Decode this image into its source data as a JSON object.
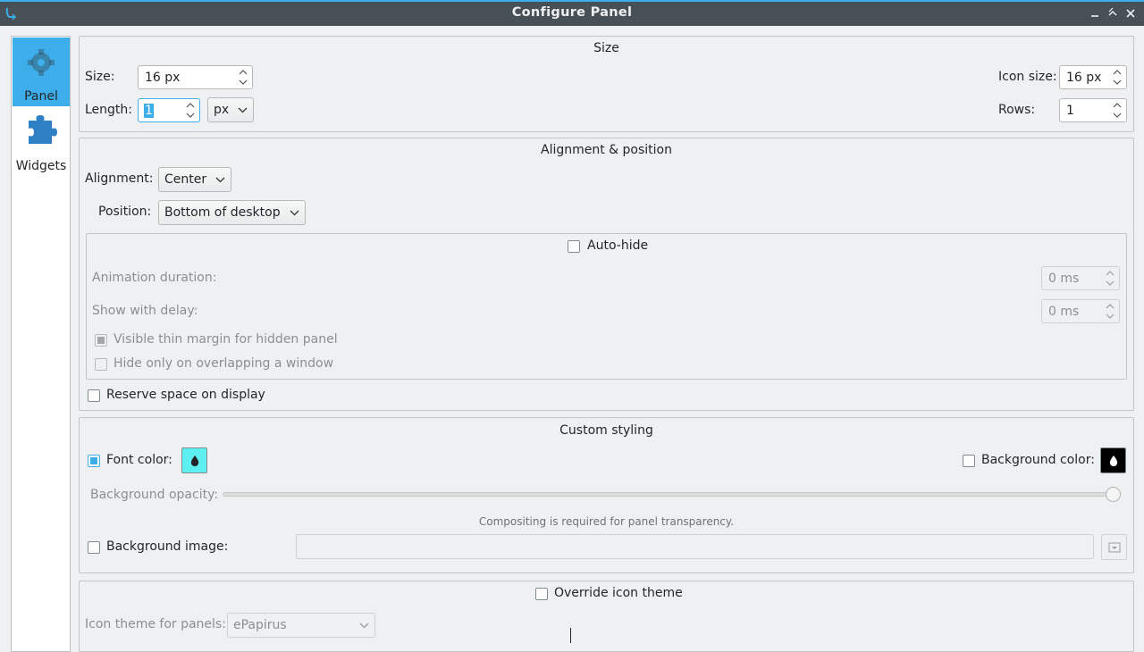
{
  "window": {
    "title": "Configure Panel"
  },
  "sidebar": {
    "items": [
      {
        "label": "Panel",
        "icon": "gear-icon",
        "selected": true
      },
      {
        "label": "Widgets",
        "icon": "puzzle-icon",
        "selected": false
      }
    ]
  },
  "size": {
    "title": "Size",
    "size_label": "Size:",
    "size_value": "16 px",
    "length_label": "Length:",
    "length_value": "1",
    "length_unit": "px",
    "icon_size_label": "Icon size:",
    "icon_size_value": "16 px",
    "rows_label": "Rows:",
    "rows_value": "1"
  },
  "alignment": {
    "title": "Alignment & position",
    "alignment_label": "Alignment:",
    "alignment_value": "Center",
    "position_label": "Position:",
    "position_value": "Bottom of desktop",
    "autohide_label": "Auto-hide",
    "animation_label": "Animation duration:",
    "animation_value": "0 ms",
    "delay_label": "Show with delay:",
    "delay_value": "0 ms",
    "thin_margin_label": "Visible thin margin for hidden panel",
    "overlap_label": "Hide only on overlapping a window",
    "reserve_label": "Reserve space on display"
  },
  "styling": {
    "title": "Custom styling",
    "font_color_label": "Font color:",
    "font_color": "#5ef0f0",
    "bg_color_label": "Background color:",
    "bg_color": "#000000",
    "opacity_label": "Background opacity:",
    "opacity": 1.0,
    "compositing_note": "Compositing is required for panel transparency.",
    "bg_image_label": "Background image:"
  },
  "icon_theme": {
    "override_label": "Override icon theme",
    "theme_label": "Icon theme for panels:",
    "theme_value": "ePapirus"
  }
}
